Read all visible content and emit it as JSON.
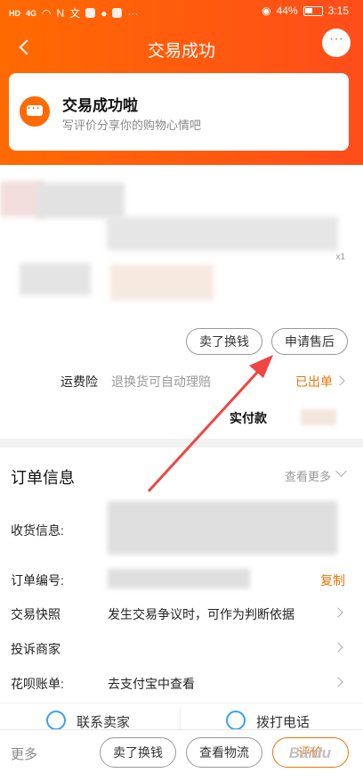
{
  "status_bar": {
    "carrier": "HD",
    "signal": "4G",
    "battery": "44%",
    "time": "3:15",
    "icons": [
      "hd-icon",
      "signal-icon",
      "wifi-icon",
      "nfc-icon",
      "wen-icon",
      "app-icon",
      "message-icon",
      "heart-icon",
      "more-icon",
      "eye-icon",
      "battery-icon"
    ]
  },
  "nav": {
    "title": "交易成功",
    "more": "···"
  },
  "success": {
    "title": "交易成功啦",
    "subtitle": "写评价分享你的购物心情吧"
  },
  "product": {
    "quantity": "x1",
    "buttons": [
      "卖了换钱",
      "申请售后"
    ],
    "freight_label": "运费险",
    "freight_desc": "退换货可自动理赔",
    "freight_status": "已出单",
    "paid_label": "实付款"
  },
  "order_info": {
    "title": "订单信息",
    "more": "查看更多",
    "rows": [
      {
        "label": "收货信息:",
        "value": ""
      },
      {
        "label": "订单编号:",
        "value": "",
        "action": "复制"
      },
      {
        "label": "交易快照",
        "value": "发生交易争议时，可作为判断依据"
      },
      {
        "label": "投诉商家",
        "value": ""
      },
      {
        "label": "花呗账单:",
        "value": "去支付宝中查看"
      }
    ],
    "contact_seller": "联系卖家",
    "call": "拨打电话"
  },
  "bottom_bar": {
    "more": "更多",
    "buttons": [
      "卖了换钱",
      "查看物流",
      "评价"
    ],
    "watermark": "Baidu"
  },
  "colors": {
    "accent": "#ff6a00",
    "orange_text": "#e8740a",
    "arrow": "#f04545"
  }
}
